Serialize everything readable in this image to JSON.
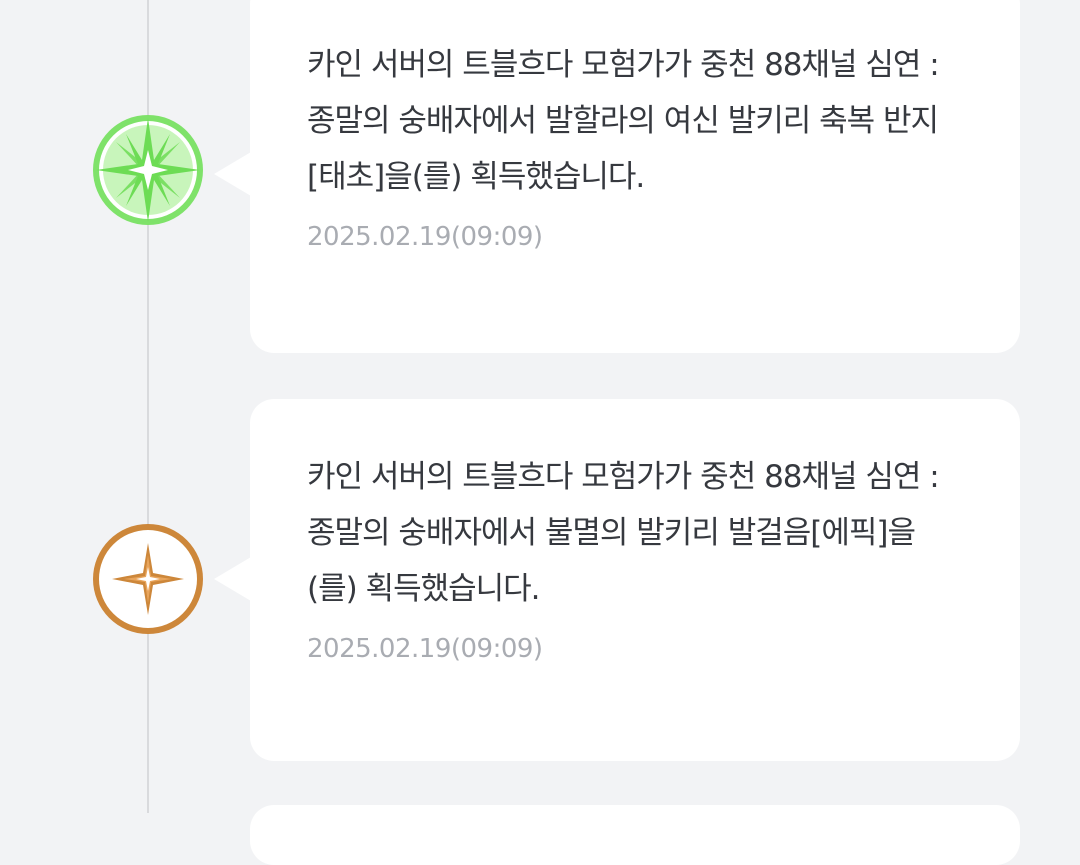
{
  "feed": {
    "items": [
      {
        "message": "카인 서버의 트블흐다 모험가가 중천 88채널 심연 : 종말의 숭배자에서 발할라의 여신 발키리 축복 반지[태초]을(를) 획득했습니다.",
        "timestamp": "2025.02.19(09:09)",
        "rarity_icon": "taecho-star-icon",
        "rarity_color": "#7fe26a"
      },
      {
        "message": "카인 서버의 트블흐다 모험가가 중천 88채널 심연 : 종말의 숭배자에서 불멸의 발키리 발걸음[에픽]을(를) 획득했습니다.",
        "timestamp": "2025.02.19(09:09)",
        "rarity_icon": "epic-star-icon",
        "rarity_color": "#cd873a"
      }
    ]
  }
}
